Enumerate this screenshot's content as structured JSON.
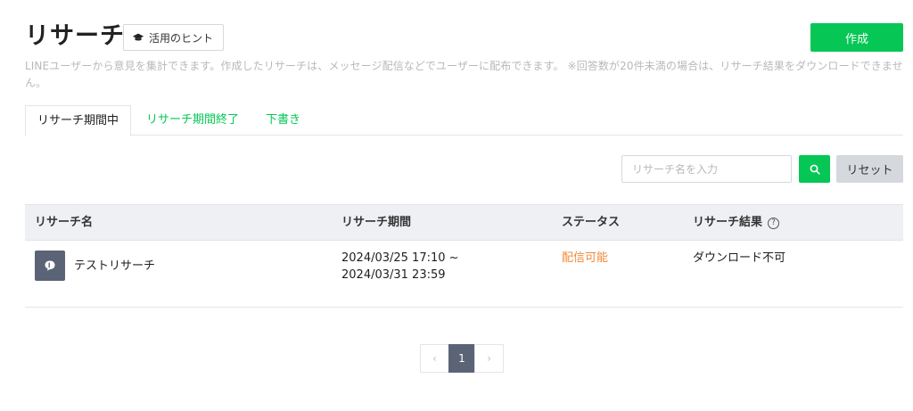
{
  "header": {
    "title": "リサーチ",
    "hint_label": "活用のヒント",
    "create_label": "作成"
  },
  "description": "LINEユーザーから意見を集計できます。作成したリサーチは、メッセージ配信などでユーザーに配布できます。 ※回答数が20件未満の場合は、リサーチ結果をダウンロードできません。",
  "tabs": [
    {
      "label": "リサーチ期間中",
      "active": true
    },
    {
      "label": "リサーチ期間終了",
      "active": false
    },
    {
      "label": "下書き",
      "active": false
    }
  ],
  "search": {
    "placeholder": "リサーチ名を入力",
    "value": "",
    "reset_label": "リセット"
  },
  "table": {
    "columns": [
      "リサーチ名",
      "リサーチ期間",
      "ステータス",
      "リサーチ結果"
    ],
    "rows": [
      {
        "name": "テストリサーチ",
        "period": "2024/03/25 17:10 ~ 2024/03/31 23:59",
        "status": "配信可能",
        "result": "ダウンロード不可"
      }
    ]
  },
  "pagination": {
    "current_page": "1",
    "prev_symbol": "‹",
    "next_symbol": "›"
  },
  "colors": {
    "brand_green": "#06c755",
    "status_orange": "#f08a38",
    "avatar_slate": "#5b6476"
  },
  "icons": {
    "hint": "graduation-cap-icon",
    "search": "search-icon",
    "row_avatar": "speech-bubble-icon",
    "help": "question-circle-icon"
  }
}
